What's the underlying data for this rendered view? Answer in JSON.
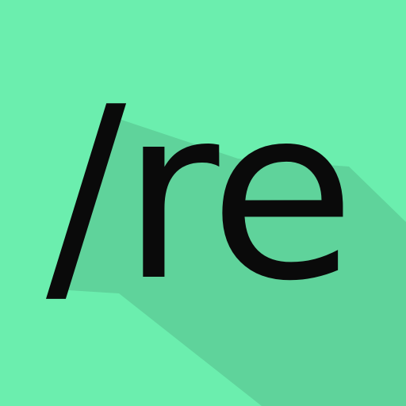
{
  "app_icon": {
    "text": "/re",
    "background_color": "#6BEEAE",
    "shadow_color": "#5FD39B",
    "text_color": "#0A0A0A"
  }
}
